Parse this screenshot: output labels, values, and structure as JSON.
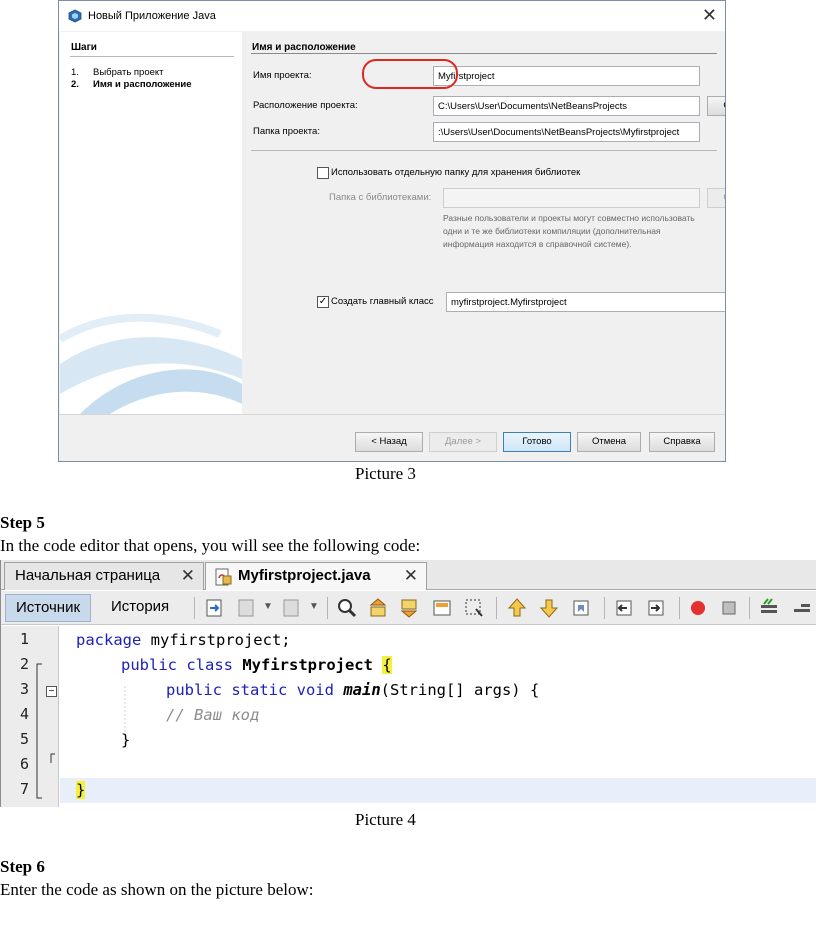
{
  "dialog": {
    "title": "Новый Приложение Java",
    "steps_header": "Шаги",
    "steps": [
      {
        "num": "1.",
        "label": "Выбрать проект"
      },
      {
        "num": "2.",
        "label": "Имя и расположение"
      }
    ],
    "section_title": "Имя и расположение",
    "project_name_label": "Имя проекта:",
    "project_name_value": "Myfirstproject",
    "location_label": "Расположение проекта:",
    "location_value": "C:\\Users\\User\\Documents\\NetBeansProjects",
    "browse_label": "Обзор...",
    "folder_label": "Папка проекта:",
    "folder_value": ":\\Users\\User\\Documents\\NetBeansProjects\\Myfirstproject",
    "separate_lib_checkbox": "Использовать отдельную папку для хранения библиотек",
    "lib_folder_label": "Папка с библиотеками:",
    "lib_browse_label": "Обзор...",
    "lib_description": "Разные пользователи и проекты могут совместно использовать одни и те же библиотеки компиляции (дополнительная информация находится в справочной системе).",
    "main_class_checkbox": "Создать главный класс",
    "main_class_value": "myfirstproject.Myfirstproject",
    "buttons": {
      "back": "< Назад",
      "next": "Далее >",
      "finish": "Готово",
      "cancel": "Отмена",
      "help": "Справка"
    }
  },
  "caption3": "Picture 3",
  "step5_title": "Step 5",
  "step5_text": "In the code editor that opens, you will see the following code:",
  "editor": {
    "tabs": [
      {
        "label": "Начальная страница",
        "active": false
      },
      {
        "label": "Myfirstproject.java",
        "active": true
      }
    ],
    "toolbar": {
      "source": "Источник",
      "history": "История"
    },
    "line_numbers": [
      "1",
      "2",
      "3",
      "4",
      "5",
      "6",
      "7"
    ],
    "code": {
      "l1_kw": "package",
      "l1_rest": " myfirstproject;",
      "l2_kw": "public class",
      "l2_name": "Myfirstproject",
      "l2_brace": "{",
      "l3_kw": "public static void",
      "l3_method": "main",
      "l3_rest": "(String[] args) {",
      "l4_comment": "// Ваш код",
      "l5": "}",
      "l7_brace": "}"
    }
  },
  "caption4": "Picture 4",
  "step6_title": "Step 6",
  "step6_text": "Enter the code as shown on the picture below:"
}
